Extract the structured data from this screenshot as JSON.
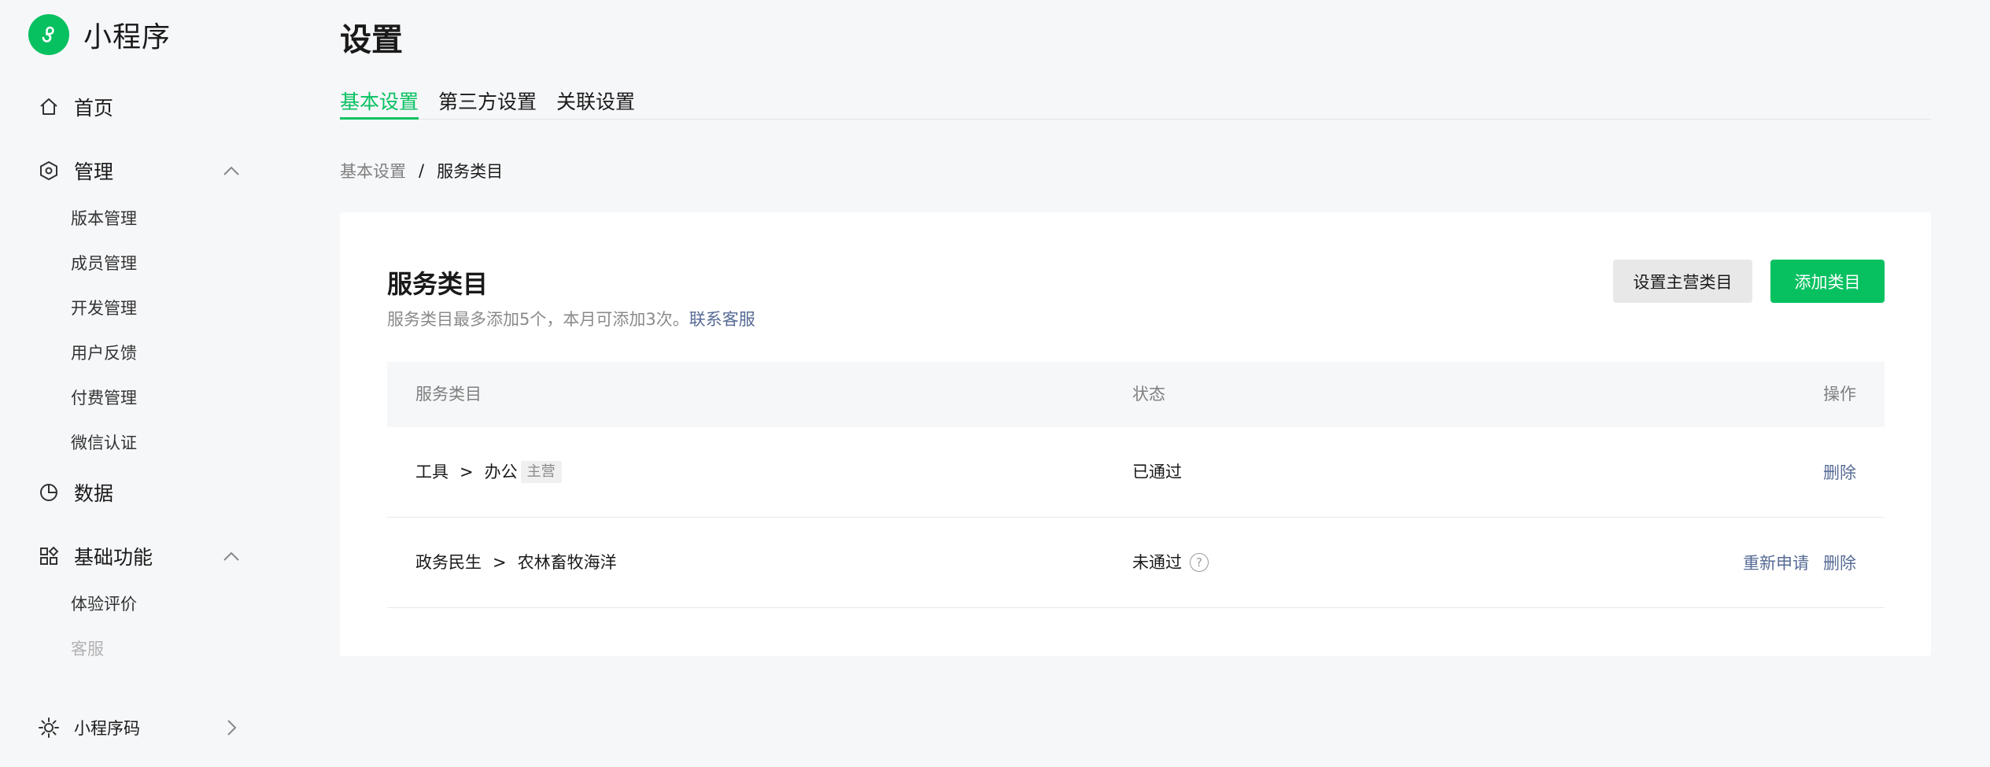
{
  "sidebar": {
    "logo_text": "小程序",
    "items": [
      {
        "label": "首页",
        "icon": "home-icon"
      },
      {
        "label": "管理",
        "icon": "hexagon-icon",
        "expanded": true
      },
      {
        "label": "数据",
        "icon": "pie-chart-icon"
      },
      {
        "label": "基础功能",
        "icon": "grid-icon",
        "expanded": true
      },
      {
        "label": "小程序码",
        "icon": "sun-icon"
      }
    ],
    "manage_sub": [
      "版本管理",
      "成员管理",
      "开发管理",
      "用户反馈",
      "付费管理",
      "微信认证"
    ],
    "basic_sub": [
      "体验评价",
      "客服"
    ]
  },
  "page": {
    "title": "设置",
    "tabs": [
      "基本设置",
      "第三方设置",
      "关联设置"
    ],
    "active_tab": 0
  },
  "breadcrumb": {
    "parent": "基本设置",
    "separator": "/",
    "current": "服务类目"
  },
  "card": {
    "title": "服务类目",
    "desc": "服务类目最多添加5个，本月可添加3次。",
    "desc_link": "联系客服",
    "btn_set_main": "设置主营类目",
    "btn_add": "添加类目"
  },
  "table": {
    "headers": {
      "category": "服务类目",
      "status": "状态",
      "ops": "操作"
    },
    "rows": [
      {
        "cat1": "工具",
        "arrow": ">",
        "cat2": "办公",
        "badge": "主营",
        "status": "已通过",
        "ops": [
          "删除"
        ]
      },
      {
        "cat1": "政务民生",
        "arrow": ">",
        "cat2": "农林畜牧海洋",
        "status": "未通过",
        "help": "?",
        "ops": [
          "重新申请",
          "删除"
        ]
      }
    ]
  },
  "colors": {
    "accent": "#07c160",
    "link": "#576b95",
    "bg": "#f6f7f9"
  }
}
